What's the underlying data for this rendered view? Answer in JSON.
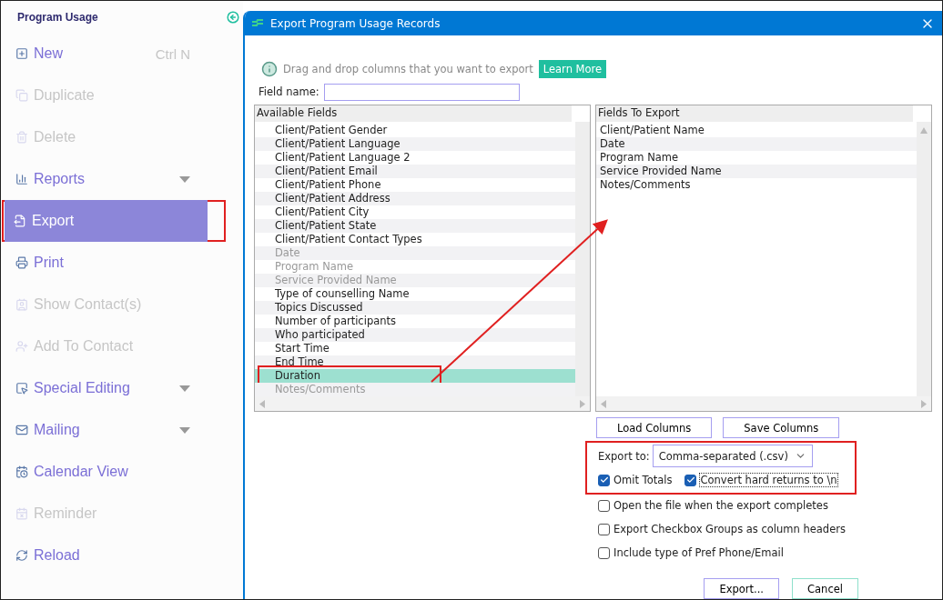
{
  "sidebar": {
    "title": "Program Usage",
    "items": [
      {
        "label": "New",
        "shortcut": "Ctrl N",
        "disabled": false,
        "selected": false,
        "expandable": false,
        "highlighted": false
      },
      {
        "label": "Duplicate",
        "disabled": true,
        "selected": false,
        "expandable": false,
        "highlighted": false
      },
      {
        "label": "Delete",
        "disabled": true,
        "selected": false,
        "expandable": false,
        "highlighted": false
      },
      {
        "label": "Reports",
        "disabled": false,
        "selected": false,
        "expandable": true,
        "highlighted": false
      },
      {
        "label": "Export",
        "disabled": false,
        "selected": true,
        "expandable": false,
        "highlighted": true
      },
      {
        "label": "Print",
        "disabled": false,
        "selected": false,
        "expandable": false,
        "highlighted": false
      },
      {
        "label": "Show Contact(s)",
        "disabled": true,
        "selected": false,
        "expandable": false,
        "highlighted": false
      },
      {
        "label": "Add To Contact",
        "disabled": true,
        "selected": false,
        "expandable": false,
        "highlighted": false
      },
      {
        "label": "Special Editing",
        "disabled": false,
        "selected": false,
        "expandable": true,
        "highlighted": false
      },
      {
        "label": "Mailing",
        "disabled": false,
        "selected": false,
        "expandable": true,
        "highlighted": false
      },
      {
        "label": "Calendar View",
        "disabled": false,
        "selected": false,
        "expandable": false,
        "highlighted": false
      },
      {
        "label": "Reminder",
        "disabled": true,
        "selected": false,
        "expandable": false,
        "highlighted": false
      },
      {
        "label": "Reload",
        "disabled": false,
        "selected": false,
        "expandable": false,
        "highlighted": false
      }
    ]
  },
  "dialog": {
    "title": "Export Program Usage Records",
    "info": "Drag and drop columns that you want to export",
    "learn_more": "Learn More",
    "field_name": {
      "label": "Field name:"
    },
    "available_fields": {
      "header": "Available Fields",
      "rows": [
        {
          "label": "Client/Patient Gender",
          "disabled": false,
          "selected": false,
          "highlighted": false
        },
        {
          "label": "Client/Patient Language",
          "disabled": false,
          "selected": false,
          "highlighted": false
        },
        {
          "label": "Client/Patient Language 2",
          "disabled": false,
          "selected": false,
          "highlighted": false
        },
        {
          "label": "Client/Patient Email",
          "disabled": false,
          "selected": false,
          "highlighted": false
        },
        {
          "label": "Client/Patient Phone",
          "disabled": false,
          "selected": false,
          "highlighted": false
        },
        {
          "label": "Client/Patient Address",
          "disabled": false,
          "selected": false,
          "highlighted": false
        },
        {
          "label": "Client/Patient City",
          "disabled": false,
          "selected": false,
          "highlighted": false
        },
        {
          "label": "Client/Patient State",
          "disabled": false,
          "selected": false,
          "highlighted": false
        },
        {
          "label": "Client/Patient Contact Types",
          "disabled": false,
          "selected": false,
          "highlighted": false
        },
        {
          "label": "Date",
          "disabled": true,
          "selected": false,
          "highlighted": false
        },
        {
          "label": "Program Name",
          "disabled": true,
          "selected": false,
          "highlighted": false
        },
        {
          "label": "Service Provided Name",
          "disabled": true,
          "selected": false,
          "highlighted": false
        },
        {
          "label": "Type of counselling Name",
          "disabled": false,
          "selected": false,
          "highlighted": false
        },
        {
          "label": "Topics Discussed",
          "disabled": false,
          "selected": false,
          "highlighted": false
        },
        {
          "label": "Number of participants",
          "disabled": false,
          "selected": false,
          "highlighted": false
        },
        {
          "label": "Who participated",
          "disabled": false,
          "selected": false,
          "highlighted": false
        },
        {
          "label": "Start Time",
          "disabled": false,
          "selected": false,
          "highlighted": false
        },
        {
          "label": "End Time",
          "disabled": false,
          "selected": false,
          "highlighted": false
        },
        {
          "label": "Duration",
          "disabled": false,
          "selected": true,
          "highlighted": true
        },
        {
          "label": "Notes/Comments",
          "disabled": true,
          "selected": false,
          "highlighted": false
        }
      ]
    },
    "fields_to_export": {
      "header": "Fields To Export",
      "rows": [
        "Client/Patient Name",
        "Date",
        "Program Name",
        "Service Provided Name",
        "Notes/Comments"
      ]
    },
    "load_columns": "Load Columns",
    "save_columns": "Save Columns",
    "export_settings": {
      "highlighted": true,
      "export_to_label": "Export to:",
      "format": "Comma-separated (.csv)"
    },
    "options": [
      {
        "label": "Omit Totals",
        "checked": true,
        "focused": false
      },
      {
        "label": "Convert hard returns to \\n",
        "checked": true,
        "focused": true
      },
      {
        "label": "Open the file when the export completes",
        "checked": false,
        "focused": false
      },
      {
        "label": "Export Checkbox Groups as column headers",
        "checked": false,
        "focused": false
      },
      {
        "label": "Include type of Pref Phone/Email",
        "checked": false,
        "focused": false
      }
    ],
    "buttons": [
      "Export...",
      "Cancel"
    ]
  }
}
